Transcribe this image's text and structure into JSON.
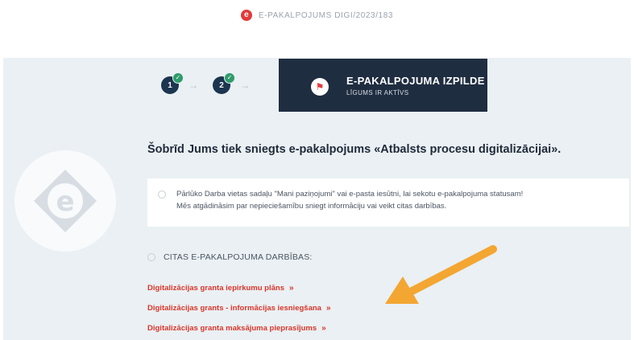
{
  "header": {
    "service_id": "E-PAKALPOJUMS DIGI/2023/183",
    "brand_color": "#e23b3b"
  },
  "stepper": {
    "steps": [
      {
        "number": "1",
        "done": true
      },
      {
        "number": "2",
        "done": true
      }
    ],
    "current": {
      "title": "E-PAKALPOJUMA IZPILDE",
      "subtitle": "LĪGUMS IR AKTĪVS"
    }
  },
  "logo_letter": "e",
  "headline": "Šobrīd Jums tiek sniegts e-pakalpojums «Atbalsts procesu digitalizācijai».",
  "info": {
    "line1": "Pārlūko Darba vietas sadaļu \"Mani paziņojumi\" vai e-pasta iesūtni, lai sekotu e-pakalpojuma statusam!",
    "line2": "Mēs atgādināsim par nepieciešamību sniegt informāciju vai veikt citas darbības."
  },
  "other_actions": {
    "label": "CITAS E-PAKALPOJUMA DARBĪBAS:",
    "links": [
      "Digitalizācijas granta iepirkumu plāns",
      "Digitalizācijas grants - informācijas iesniegšana",
      "Digitalizācijas granta maksājuma pieprasījums"
    ],
    "chevron": "»"
  },
  "colors": {
    "panel_bg": "#eaf0f3",
    "step_dark": "#1c3550",
    "current_step_bg": "#1f2d40",
    "check_green": "#2e9b6c",
    "link_red": "#d9352b",
    "pointer_orange": "#f3a632"
  }
}
